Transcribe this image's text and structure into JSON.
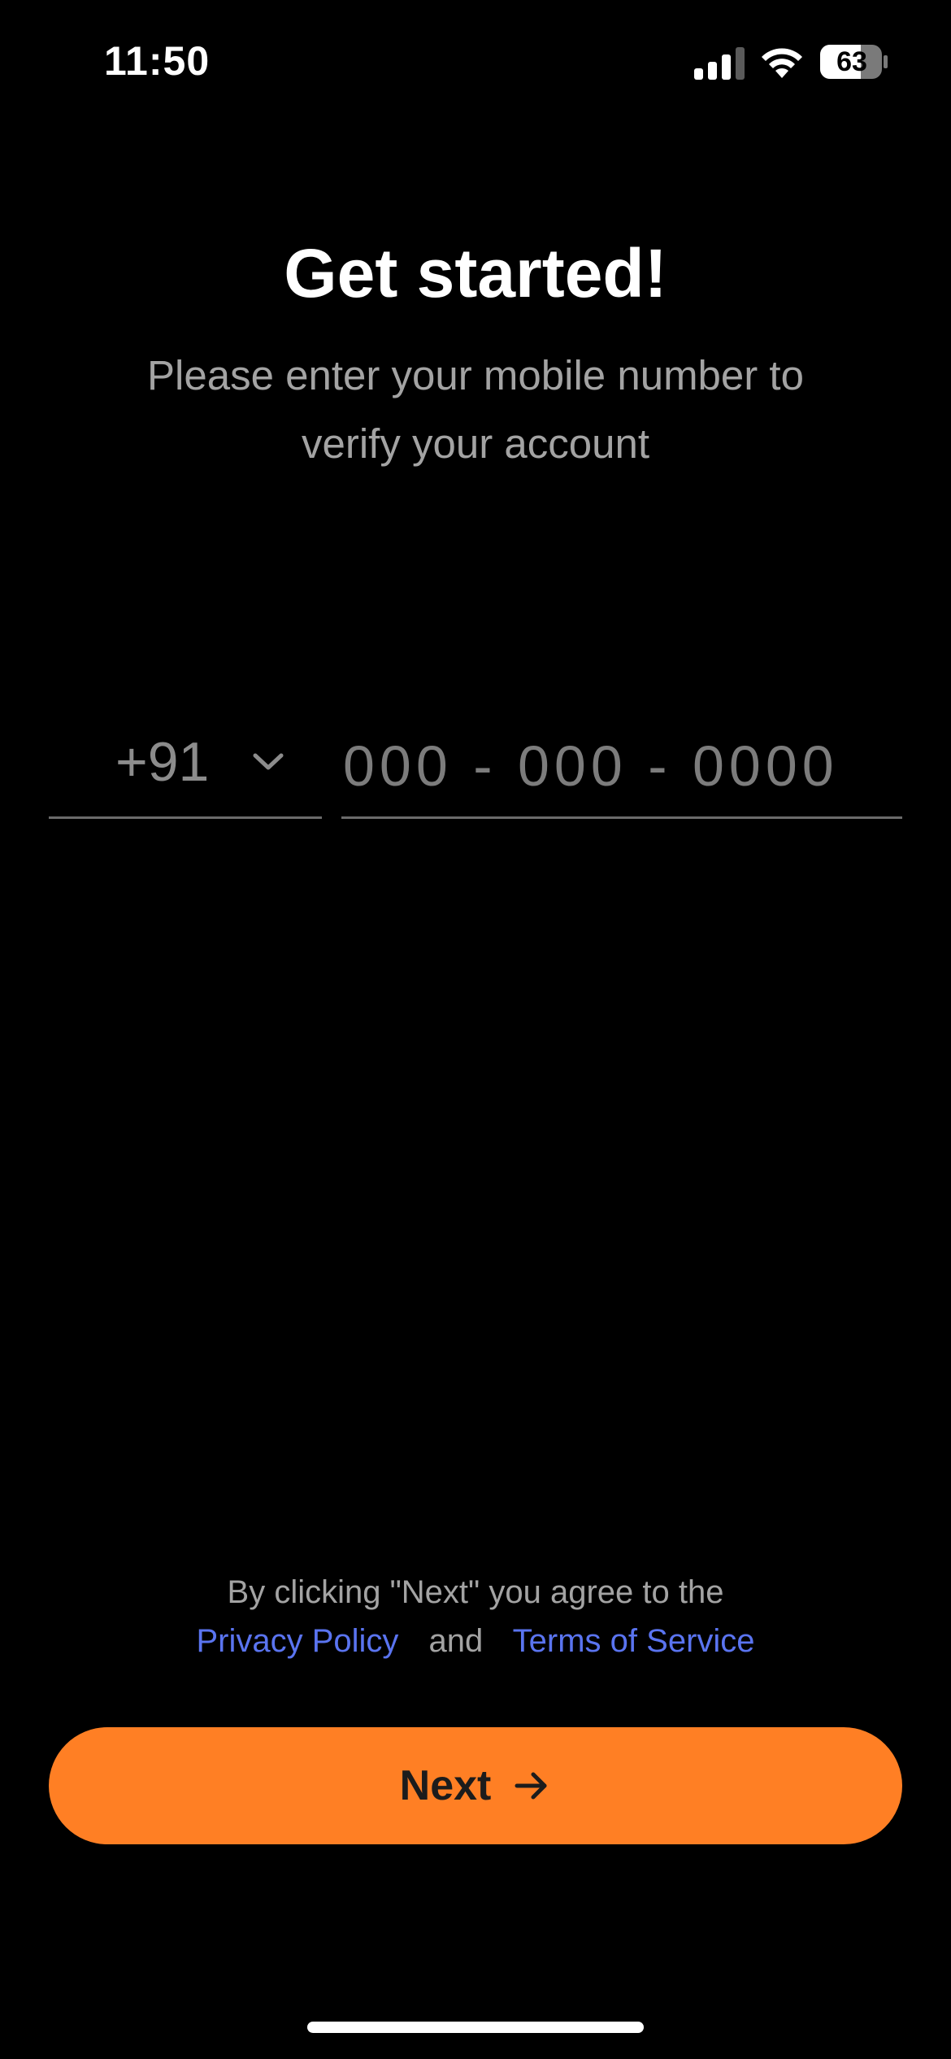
{
  "status_bar": {
    "time": "11:50",
    "battery_level": "63",
    "signal_icon": "cellular-signal-icon",
    "wifi_icon": "wifi-icon",
    "battery_icon": "battery-icon"
  },
  "header": {
    "title": "Get started!",
    "subtitle": "Please enter your mobile number to verify your account"
  },
  "phone_form": {
    "country_code": "+91",
    "country_code_icon": "chevron-down-icon",
    "phone_value": "",
    "phone_placeholder": "000 - 000 - 0000"
  },
  "terms": {
    "agreement_text": "By clicking \"Next\" you agree to the",
    "privacy_policy_label": "Privacy Policy",
    "and_label": "and",
    "terms_of_service_label": "Terms of Service"
  },
  "actions": {
    "next_label": "Next",
    "next_icon": "arrow-right-icon"
  },
  "colors": {
    "background": "#000000",
    "accent": "#ff7f24",
    "link": "#5a74f0",
    "muted_text": "#a3a3a3"
  }
}
